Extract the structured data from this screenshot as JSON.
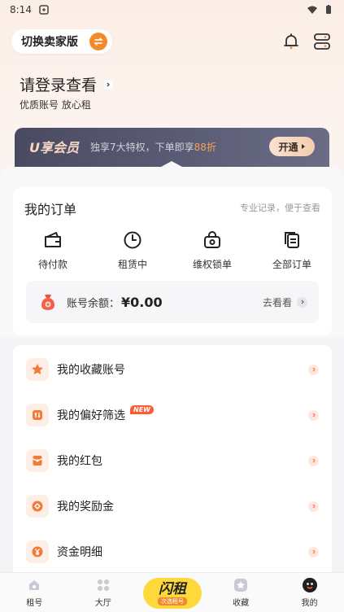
{
  "status_bar": {
    "time": "8:14"
  },
  "header": {
    "switch_label": "切换卖家版",
    "bell_icon": "bell-icon",
    "menu_icon": "menu-icon"
  },
  "login": {
    "title": "请登录查看",
    "subtitle": "优质账号 放心租"
  },
  "vip": {
    "title": "U享会员",
    "text_prefix": "独享7大特权，下单即享",
    "text_highlight": "88折",
    "button": "开通",
    "colors": {
      "banner": "#4a4b63",
      "highlight": "#f0a35c"
    }
  },
  "orders": {
    "title": "我的订单",
    "note": "专业记录，便于查看",
    "items": [
      {
        "label": "待付款",
        "icon": "wallet-icon"
      },
      {
        "label": "租赁中",
        "icon": "clock-icon"
      },
      {
        "label": "维权锁单",
        "icon": "lock-bag-icon"
      },
      {
        "label": "全部订单",
        "icon": "documents-icon"
      }
    ],
    "balance_label": "账号余额：",
    "balance_value": "¥0.00",
    "balance_link": "去看看"
  },
  "menu": {
    "items": [
      {
        "label": "我的收藏账号",
        "icon": "star-icon"
      },
      {
        "label": "我的偏好筛选",
        "icon": "filter-icon",
        "badge": "NEW"
      },
      {
        "label": "我的红包",
        "icon": "red-packet-icon"
      },
      {
        "label": "我的奖励金",
        "icon": "coin-icon"
      },
      {
        "label": "资金明细",
        "icon": "yen-icon"
      }
    ]
  },
  "tabs": {
    "items": [
      {
        "label": "租号",
        "icon": "home-icon"
      },
      {
        "label": "大厅",
        "icon": "grid-icon"
      },
      {
        "label": "收藏",
        "icon": "star-icon"
      },
      {
        "label": "我的",
        "icon": "profile-icon"
      }
    ],
    "center_main": "闪租",
    "center_sub": "次选租号"
  },
  "colors": {
    "accent": "#f38a2a",
    "tab_center": "#ffd93b"
  }
}
